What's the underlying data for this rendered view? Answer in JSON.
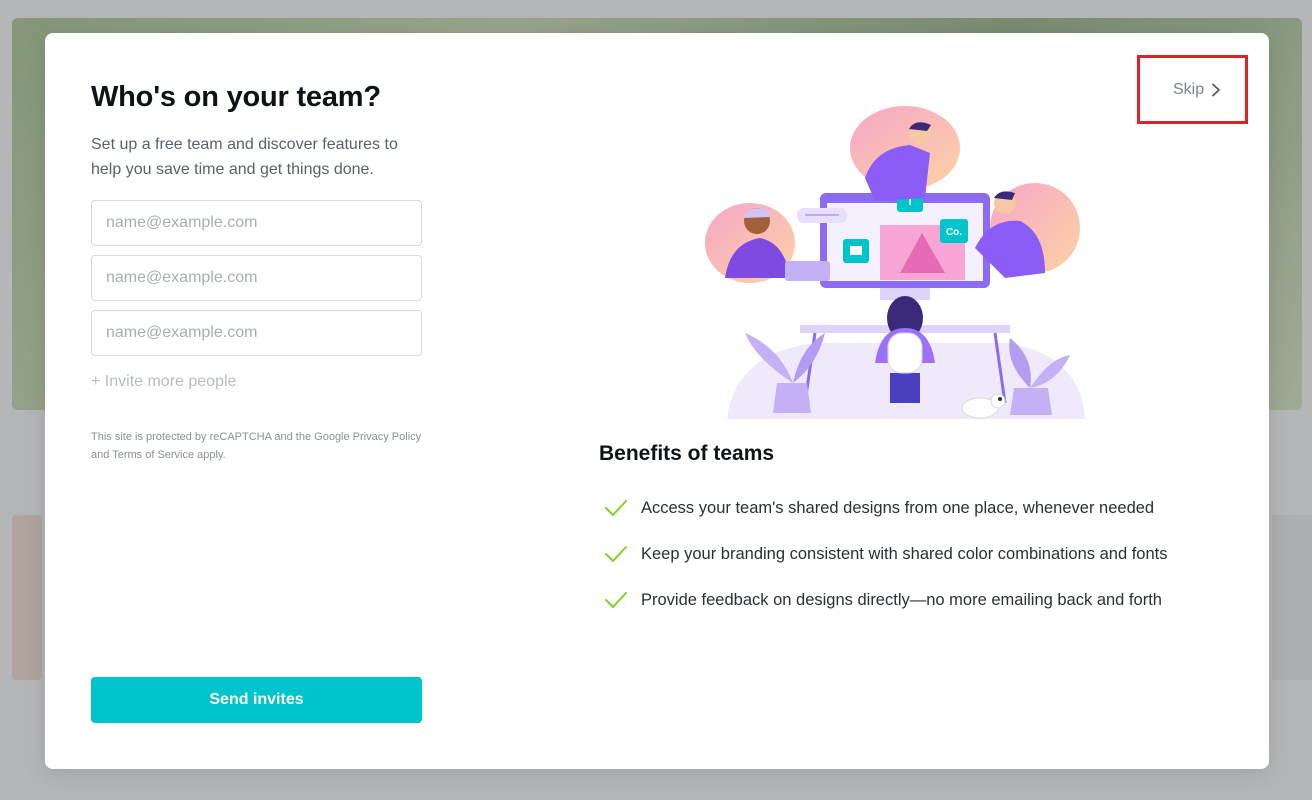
{
  "modal": {
    "title": "Who's on your team?",
    "subtitle": "Set up a free team and discover features to help you save time and get things done.",
    "email_inputs": [
      {
        "placeholder": "name@example.com",
        "value": ""
      },
      {
        "placeholder": "name@example.com",
        "value": ""
      },
      {
        "placeholder": "name@example.com",
        "value": ""
      }
    ],
    "invite_more_label": "+ Invite more people",
    "recaptcha_text": "This site is protected by reCAPTCHA and the Google Privacy Policy and Terms of Service apply.",
    "send_button_label": "Send invites",
    "skip_label": "Skip",
    "illustration_badges": [
      "T",
      "Co."
    ],
    "benefits": {
      "title": "Benefits of teams",
      "items": [
        "Access your team's shared designs from one place, whenever needed",
        "Keep your branding consistent with shared color combinations and fonts",
        "Provide feedback on designs directly—no more emailing back and forth"
      ]
    }
  },
  "colors": {
    "accent": "#00c4cc",
    "check": "#7ed321",
    "highlight_box": "#e0202a",
    "illustration_purple": "#8b5cf6"
  }
}
